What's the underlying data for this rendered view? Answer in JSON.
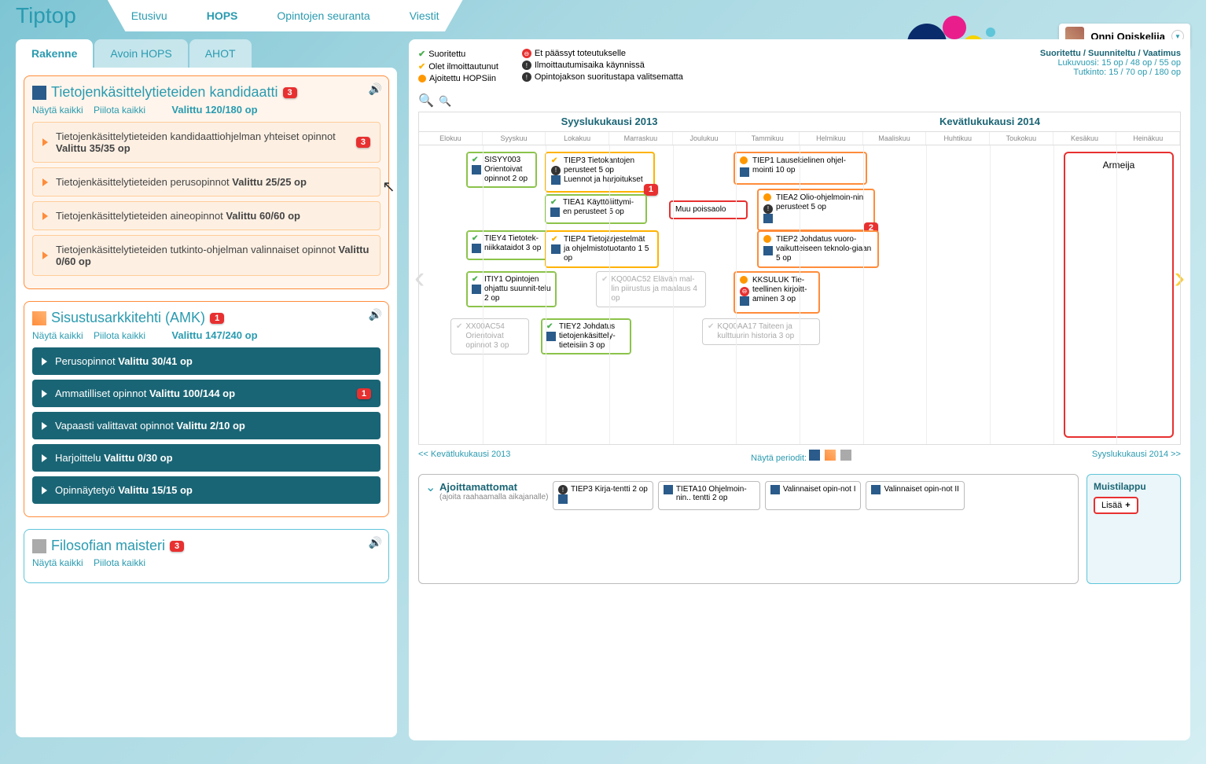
{
  "app": {
    "logo": "Tiptop"
  },
  "topnav": {
    "home": "Etusivu",
    "hops": "HOPS",
    "tracking": "Opintojen seuranta",
    "messages": "Viestit"
  },
  "user": {
    "name": "Onni Opiskelija"
  },
  "tabs": {
    "structure": "Rakenne",
    "open": "Avoin HOPS",
    "ahot": "AHOT"
  },
  "degree1": {
    "title": "Tietojenkäsittelytieteiden kandidaatti",
    "badge": "3",
    "show_all": "Näytä kaikki",
    "hide_all": "Piilota kaikki",
    "selected": "Valittu 120/180 op",
    "sect1": "Tietojenkäsittelytieteiden kandidaattiohjelman yhteiset opinnot ",
    "sect1b": "Valittu 35/35 op",
    "sect1badge": "3",
    "sect2": "Tietojenkäsittelytieteiden perusopinnot ",
    "sect2b": "Valittu 25/25 op",
    "sect3": "Tietojenkäsittelytieteiden aineopinnot ",
    "sect3b": "Valittu 60/60 op",
    "sect4": "Tietojenkäsittelytieteiden tutkinto-ohjelman valinnaiset opinnot ",
    "sect4b": "Valittu 0/60 op"
  },
  "degree2": {
    "title": "Sisustusarkkitehti (AMK)",
    "badge": "1",
    "show_all": "Näytä kaikki",
    "hide_all": "Piilota kaikki",
    "selected": "Valittu 147/240 op",
    "sect1": "Perusopinnot ",
    "sect1b": "Valittu 30/41 op",
    "sect2": "Ammatilliset opinnot ",
    "sect2b": "Valittu 100/144 op",
    "sect2badge": "1",
    "sect3": "Vapaasti valittavat opinnot ",
    "sect3b": "Valittu 2/10 op",
    "sect4": "Harjoittelu ",
    "sect4b": "Valittu 0/30 op",
    "sect5": "Opinnäytetyö ",
    "sect5b": "Valittu 15/15 op"
  },
  "degree3": {
    "title": "Filosofian maisteri",
    "badge": "3",
    "show_all": "Näytä kaikki",
    "hide_all": "Piilota kaikki"
  },
  "legend": {
    "done": "Suoritettu",
    "enrolled": "Olet ilmoittautunut",
    "scheduled": "Ajoitettu HOPSiin",
    "noaccess": "Et päässyt toteutukselle",
    "enroll_open": "Ilmoittautumisaika käynnissä",
    "method": "Opintojakson suoritustapa valitsematta"
  },
  "summary": {
    "header": "Suoritettu / Suunniteltu / Vaatimus",
    "year": "Lukuvuosi: 15 op / 48 op / 55 op",
    "degree": "Tutkinto: 15 / 70 op / 180 op"
  },
  "semesters": {
    "fall": "Syyslukukausi 2013",
    "spring": "Kevätlukukausi 2014"
  },
  "months": [
    "Elokuu",
    "Syyskuu",
    "Lokakuu",
    "Marraskuu",
    "Joulukuu",
    "Tammikuu",
    "Helmikuu",
    "Maaliskuu",
    "Huhtikuu",
    "Toukokuu",
    "Kesäkuu",
    "Heinäkuu"
  ],
  "courses": {
    "c1": "SISYY003 Orientoivat opinnot 2 op",
    "c2": "TIEP3 Tietokantojen perusteet 5 op",
    "c2b": "Luennot ja harjoitukset",
    "c3": "TIEA1 Käyttöliittymi-en perusteet 5 op",
    "c4": "TIEY4 Tietotek-niikkataidot 3 op",
    "c5": "TIEP4 Tietojärjestelmät ja ohjelmistotuotanto 1 5 op",
    "c6": "ITIY1 Opintojen ohjattu suunnit-telu 2 op",
    "c7": "KQ00AC52 Elävän mal-lin piirustus ja maalaus 4 op",
    "c8": "XX00AC54 Orientoivat opinnot 3 op",
    "c9": "TIEY2 Johdatus tietojenkäsittely-tieteisiin 3 op",
    "c10": "TIEP1 Lausekielinen ohjel-mointi 10 op",
    "c11": "TIEA2 Olio-ohjelmoin-nin perusteet 5 op",
    "c12": "TIEP2 Johdatus vuoro-vaikutteiseen teknolo-giaan 5 op",
    "c13": "KKSULUK Tie-teellinen kirjoitt-aminen 3 op",
    "c14": "KQ00AA17 Taiteen ja kulttuurin historia 3 op",
    "muu": "Muu poissaolo",
    "armeija": "Armeija"
  },
  "badges": {
    "b1": "1",
    "b2": "2"
  },
  "tlfooter": {
    "prev": "<< Kevätlukukausi 2013",
    "periods": "Näytä periodit:",
    "next": "Syyslukukausi 2014 >>"
  },
  "unscheduled": {
    "title": "Ajoittamattomat",
    "sub": "(ajoita raahaamalla aikajanalle)",
    "i1": "TIEP3 Kirja-tentti 2 op",
    "i2": "TIETA10  Ohjelmoin-nin.. tentti 2 op",
    "i3": "Valinnaiset opin-not I",
    "i4": "Valinnaiset opin-not II"
  },
  "notes": {
    "title": "Muistilappu",
    "add": "Lisää"
  }
}
